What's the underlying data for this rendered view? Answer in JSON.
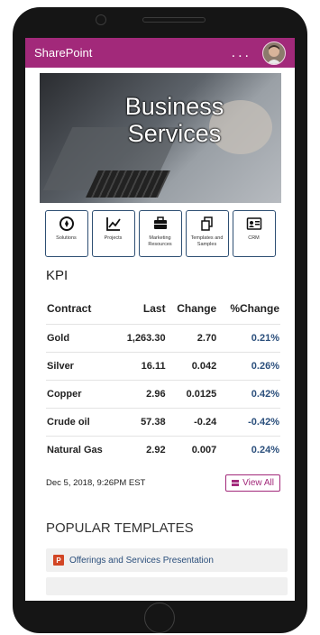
{
  "app": {
    "title": "SharePoint",
    "more": "..."
  },
  "hero": {
    "title_line1": "Business",
    "title_line2": "Services"
  },
  "tiles": [
    {
      "label": "Solutions",
      "icon": "compass-icon"
    },
    {
      "label": "Projects",
      "icon": "chart-line-icon"
    },
    {
      "label": "Marketing Resources",
      "icon": "briefcase-icon"
    },
    {
      "label": "Templates and Samples",
      "icon": "copy-documents-icon"
    },
    {
      "label": "CRM",
      "icon": "contact-card-icon"
    }
  ],
  "kpi": {
    "title": "KPI",
    "headers": [
      "Contract",
      "Last",
      "Change",
      "%Change"
    ],
    "rows": [
      [
        "Gold",
        "1,263.30",
        "2.70",
        "0.21%"
      ],
      [
        "Silver",
        "16.11",
        "0.042",
        "0.26%"
      ],
      [
        "Copper",
        "2.96",
        "0.0125",
        "0.42%"
      ],
      [
        "Crude oil",
        "57.38",
        "-0.24",
        "-0.42%"
      ],
      [
        "Natural Gas",
        "2.92",
        "0.007",
        "0.24%"
      ]
    ],
    "timestamp": "Dec 5, 2018, 9:26PM EST",
    "view_all": "View All"
  },
  "popular": {
    "title": "POPULAR TEMPLATES",
    "items": [
      "Offerings and Services Presentation"
    ]
  },
  "colors": {
    "brand": "#a2297a",
    "link": "#2b4f7c"
  }
}
